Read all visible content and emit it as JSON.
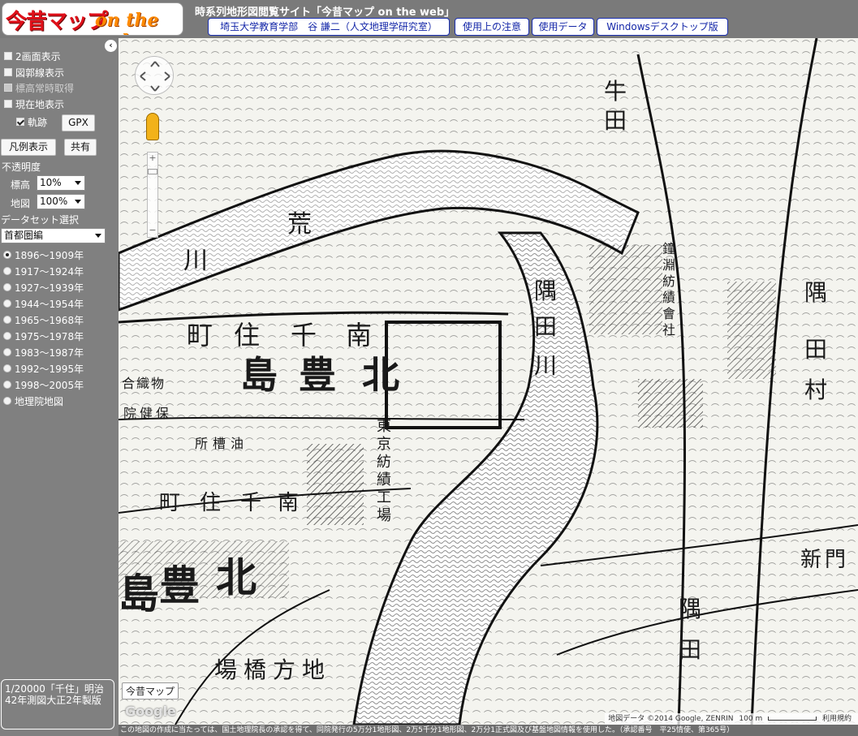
{
  "header": {
    "logo_main": "今昔マップ",
    "logo_sub": "on the web",
    "site_title": "時系列地形図閲覧サイト「今昔マップ on the web」",
    "buttons": [
      "埼玉大学教育学部　谷 謙二（人文地理学研究室）",
      "使用上の注意",
      "使用データ",
      "Windowsデスクトップ版"
    ]
  },
  "sidebar": {
    "collapse_glyph": "‹",
    "options": [
      {
        "label": "2画面表示",
        "checked": false
      },
      {
        "label": "図郭線表示",
        "checked": false
      },
      {
        "label": "標高常時取得",
        "checked": false
      },
      {
        "label": "現在地表示",
        "checked": false
      }
    ],
    "track_label": "軌跡",
    "gpx_label": "GPX",
    "legend_button": "凡例表示",
    "share_button": "共有",
    "opacity_title": "不透明度",
    "elevation_label": "標高",
    "elevation_value": "10%",
    "map_label": "地図",
    "map_value": "100%",
    "dataset_title": "データセット選択",
    "dataset_value": "首都圏編",
    "periods": [
      "1896～1909年",
      "1917～1924年",
      "1927～1939年",
      "1944～1954年",
      "1965～1968年",
      "1975～1978年",
      "1983～1987年",
      "1992～1995年",
      "1998～2005年",
      "地理院地図"
    ],
    "selected_period": 0,
    "info": "1/20000「千住」明治42年測図大正2年製版"
  },
  "map": {
    "labels": [
      "荒",
      "川",
      "隅",
      "田",
      "川",
      "南",
      "千",
      "住",
      "町",
      "北",
      "豊",
      "島",
      "牛",
      "田",
      "隅",
      "田",
      "村",
      "東",
      "京",
      "紡",
      "績",
      "工",
      "場",
      "鐘",
      "淵",
      "紡",
      "績",
      "會",
      "社",
      "隅",
      "田",
      "新",
      "門",
      "地",
      "方",
      "橋",
      "場",
      "南",
      "千",
      "住",
      "町",
      "北",
      "豊",
      "島",
      "油",
      "槽",
      "所",
      "保",
      "健",
      "院",
      "合",
      "織",
      "物"
    ],
    "map_type": "今昔マップ",
    "google": "Google",
    "attribution": "地図データ ©2014 Google, ZENRIN",
    "scale": "100 m",
    "terms": "利用規約"
  },
  "footer": "この地図の作成に当たっては、国土地理院長の承認を得て、同院発行の5万分1地形図、2万5千分1地形図、2万分1正式図及び基盤地図情報を使用した。（承認番号　平25情使、第365号）"
}
